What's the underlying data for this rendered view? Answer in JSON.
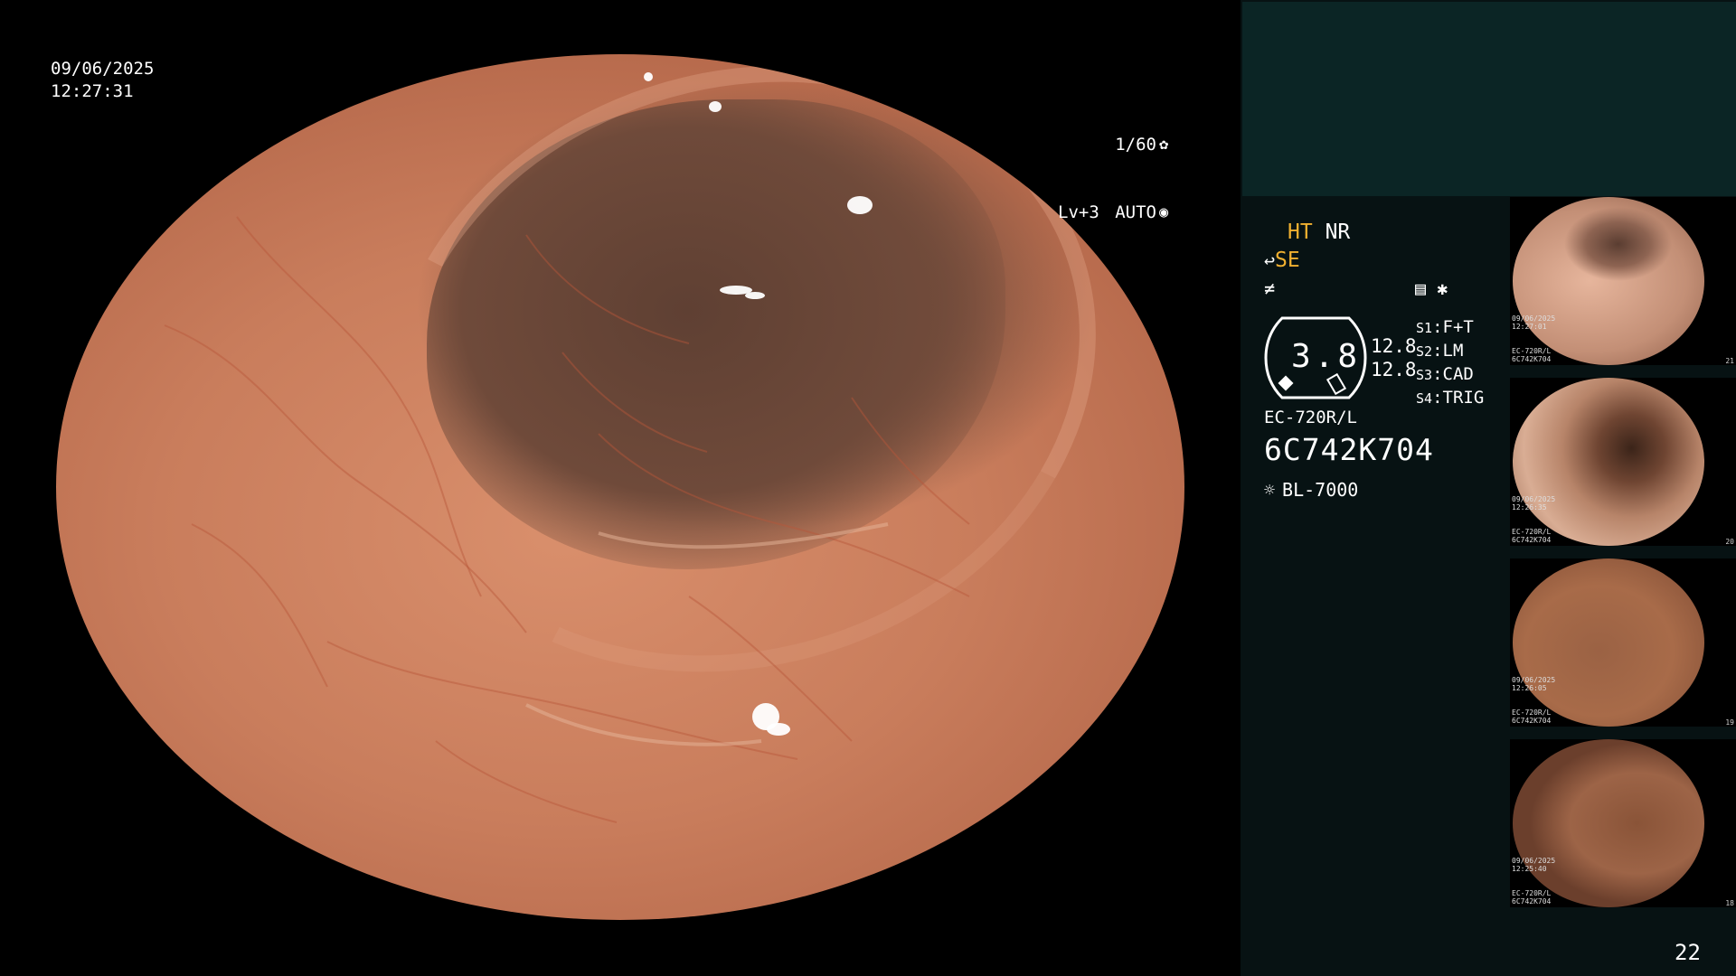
{
  "overlay": {
    "date": "09/06/2025",
    "time": "12:27:31",
    "shutter": "1/60",
    "shutter_icon": "aperture-icon",
    "level": "Lv+3",
    "mode": "AUTO",
    "mode_icon": "iris-icon"
  },
  "panel": {
    "enhance_ht": "HT",
    "enhance_nr": "NR",
    "se_label": "SE",
    "gauge_value": "3.8",
    "ratio_top": "12.8",
    "ratio_bottom": "12.8",
    "scopes": [
      {
        "key": "S1",
        "value": "F+T"
      },
      {
        "key": "S2",
        "value": "LM"
      },
      {
        "key": "S3",
        "value": "CAD"
      },
      {
        "key": "S4",
        "value": "TRIG"
      }
    ],
    "model": "EC-720R/L",
    "serial": "6C742K704",
    "lamp": "BL-7000",
    "colors": {
      "amber": "#f0b030",
      "header": "#0b2525"
    }
  },
  "thumbnails": [
    {
      "caption": "09/06/2025\n12:27:01\n\n\nEC-720R/L\n6C742K704",
      "number": "21"
    },
    {
      "caption": "09/06/2025\n12:26:35\n\n\nEC-720R/L\n6C742K704",
      "number": "20"
    },
    {
      "caption": "09/06/2025\n12:26:05\n\n\nEC-720R/L\n6C742K704",
      "number": "19"
    },
    {
      "caption": "09/06/2025\n12:25:40\n\n\nEC-720R/L\n6C742K704",
      "number": "18"
    }
  ],
  "page_number": "22"
}
